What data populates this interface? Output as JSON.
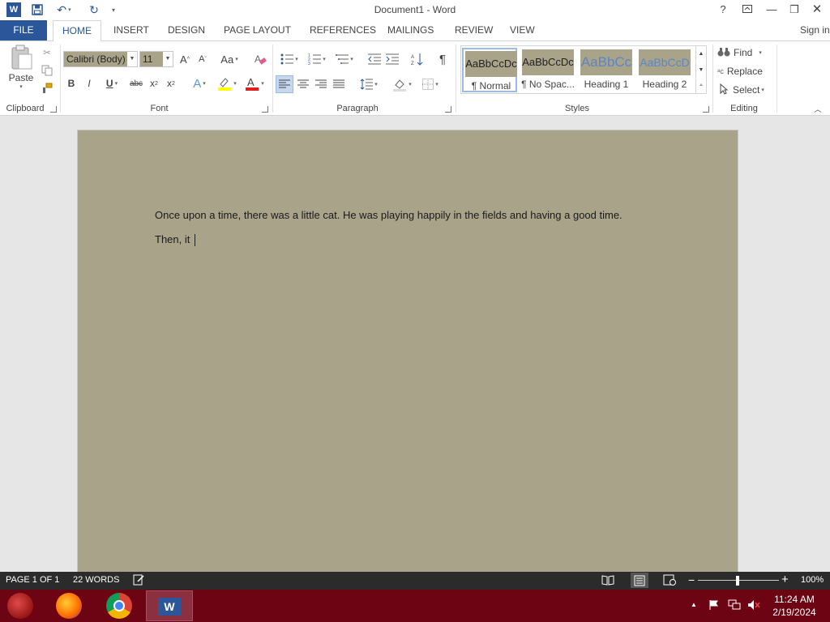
{
  "window": {
    "title": "Document1 - Word",
    "sign_in": "Sign in",
    "help": "?"
  },
  "tabs": [
    "FILE",
    "HOME",
    "INSERT",
    "DESIGN",
    "PAGE LAYOUT",
    "REFERENCES",
    "MAILINGS",
    "REVIEW",
    "VIEW"
  ],
  "ribbon": {
    "clipboard": {
      "label": "Clipboard",
      "paste": "Paste"
    },
    "font": {
      "label": "Font",
      "family": "Calibri (Body)",
      "size": "11",
      "grow": "A",
      "shrink": "A",
      "change_case": "Aa",
      "bold": "B",
      "italic": "I",
      "underline": "U",
      "strike": "abc",
      "subscript": "x",
      "superscript": "x"
    },
    "paragraph": {
      "label": "Paragraph",
      "pilcrow": "¶"
    },
    "styles": {
      "label": "Styles",
      "items": [
        {
          "sample": "AaBbCcDc",
          "name": "¶ Normal"
        },
        {
          "sample": "AaBbCcDc",
          "name": "¶ No Spac..."
        },
        {
          "sample": "AaBbCc",
          "name": "Heading 1"
        },
        {
          "sample": "AaBbCcD",
          "name": "Heading 2"
        }
      ]
    },
    "editing": {
      "label": "Editing",
      "find": "Find",
      "replace": "Replace",
      "select": "Select"
    }
  },
  "document": {
    "paragraphs": [
      "Once upon a time, there was a little cat. He was playing happily in the fields and having a good time.",
      "Then, it"
    ]
  },
  "status": {
    "page": "PAGE 1 OF 1",
    "words": "22 WORDS",
    "zoom": "100%"
  },
  "taskbar": {
    "time": "11:24 AM",
    "date": "2/19/2024"
  },
  "colors": {
    "accent": "#2b579a",
    "page_background": "#a9a38a",
    "status_bar": "#2b2b2b",
    "taskbar": "#6d0414"
  }
}
